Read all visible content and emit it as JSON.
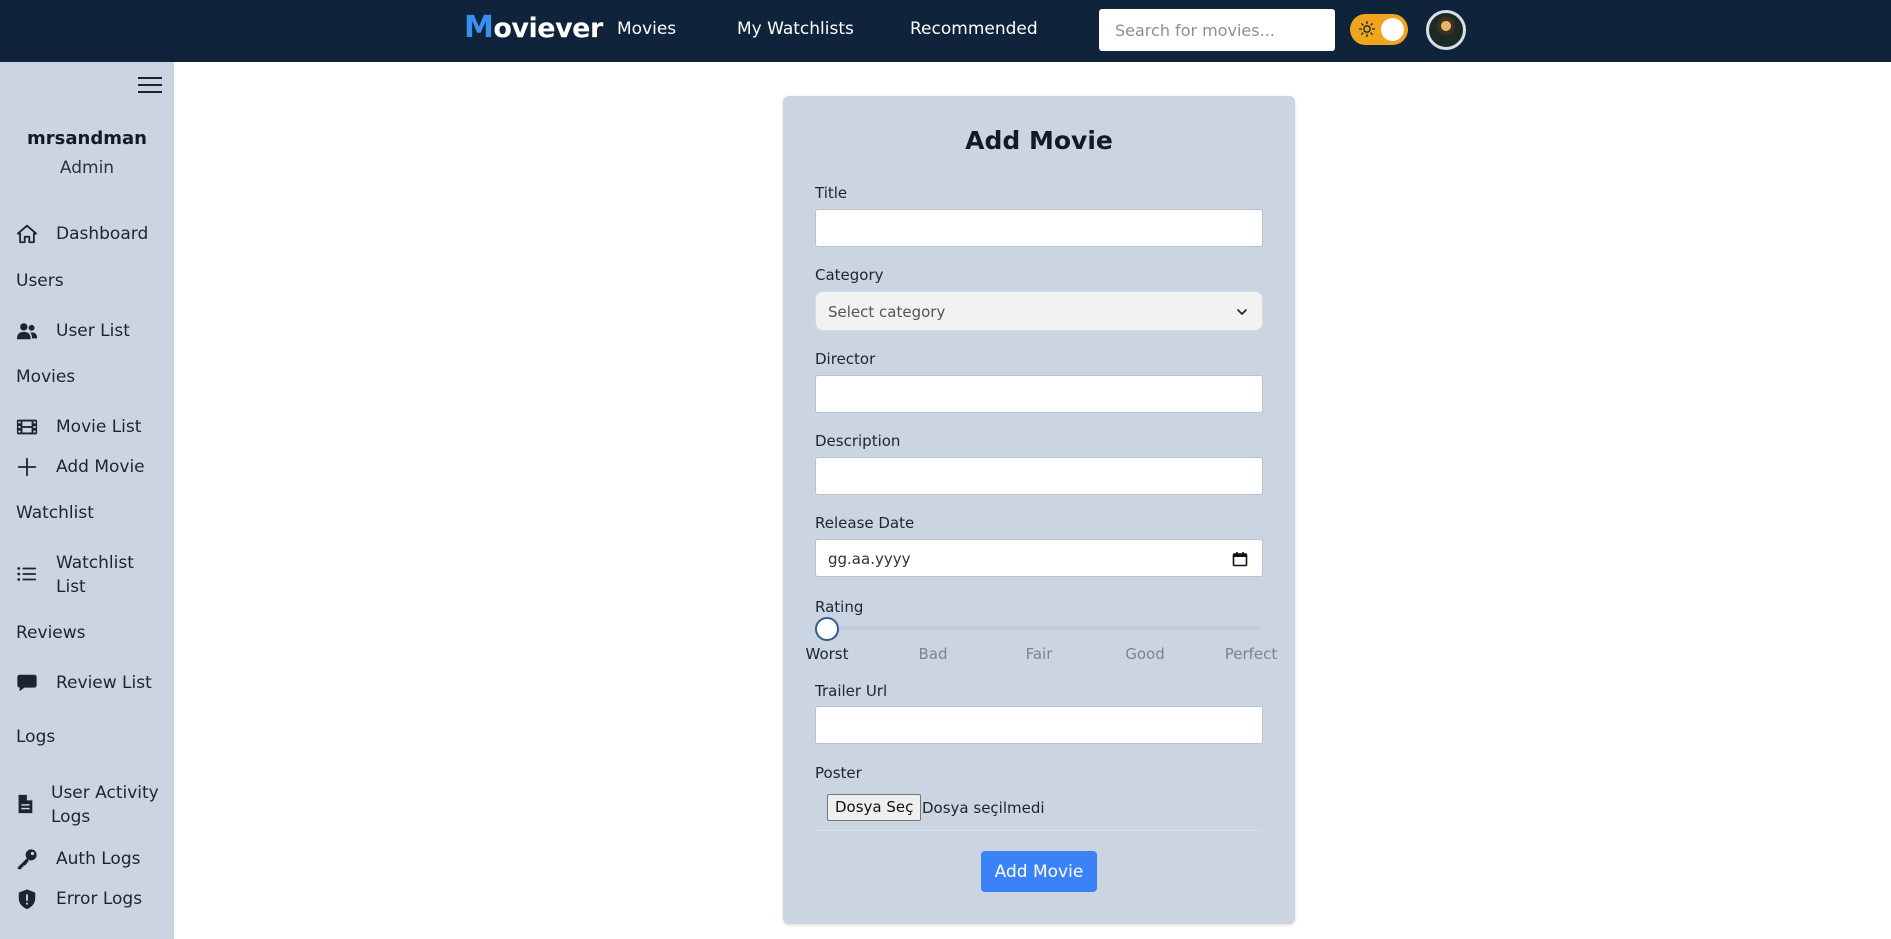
{
  "header": {
    "brand_first": "M",
    "brand_rest": "oviever",
    "nav": [
      "Movies",
      "My Watchlists",
      "Recommended"
    ],
    "search_placeholder": "Search for movies...",
    "theme_toggle": "light",
    "accent_color": "#3a8ff0",
    "nav_bg": "#0f243b"
  },
  "sidebar": {
    "user_name": "mrsandman",
    "user_role": "Admin",
    "items": {
      "dashboard": "Dashboard",
      "users_section": "Users",
      "user_list": "User List",
      "movies_section": "Movies",
      "movie_list": "Movie List",
      "add_movie": "Add Movie",
      "watchlist_section": "Watchlist",
      "watchlist_list_1": "Watchlist",
      "watchlist_list_2": "List",
      "reviews_section": "Reviews",
      "review_list": "Review List",
      "logs_section": "Logs",
      "user_activity_1": "User Activity",
      "user_activity_2": "Logs",
      "auth_logs": "Auth Logs",
      "error_logs": "Error Logs"
    },
    "icons": [
      "home-icon",
      "users-icon",
      "film-icon",
      "plus-icon",
      "list-icon",
      "comment-icon",
      "file-icon",
      "key-icon",
      "shield-icon"
    ]
  },
  "form": {
    "title": "Add Movie",
    "labels": {
      "title": "Title",
      "category": "Category",
      "director": "Director",
      "description": "Description",
      "release_date": "Release Date",
      "rating": "Rating",
      "trailer_url": "Trailer Url",
      "poster": "Poster"
    },
    "values": {
      "title": "",
      "director": "",
      "description": "",
      "trailer_url": ""
    },
    "category_placeholder": "Select category",
    "release_date_placeholder": "gg.aa.yyyy",
    "rating_options": [
      "Worst",
      "Bad",
      "Fair",
      "Good",
      "Perfect"
    ],
    "rating_selected": "Worst",
    "file_button": "Dosya Seç",
    "file_status": "Dosya seçilmedi",
    "submit": "Add Movie",
    "submit_color": "#3b82f6"
  }
}
